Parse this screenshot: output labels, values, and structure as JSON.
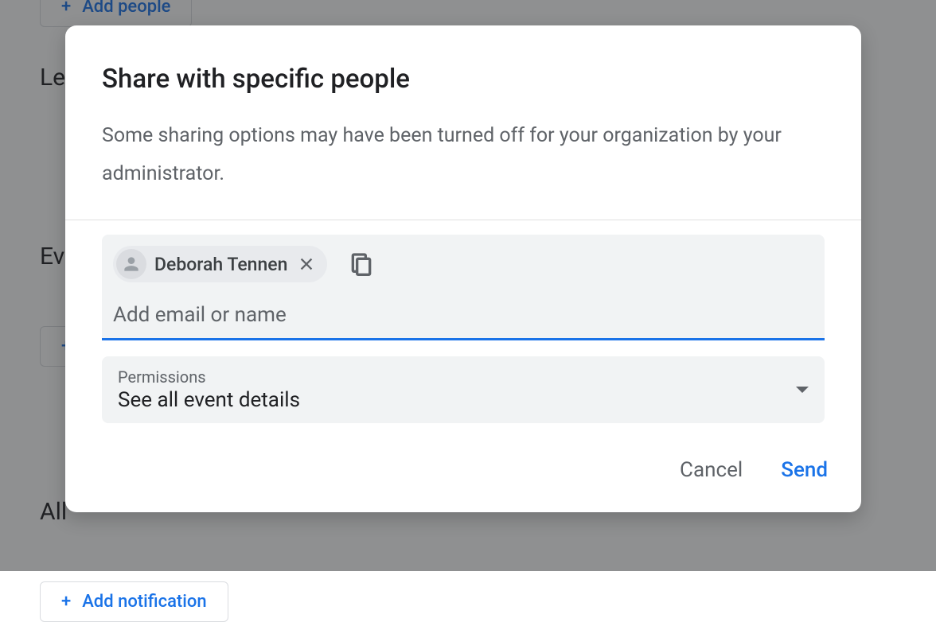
{
  "background": {
    "add_people_label": "Add people",
    "learn_text": "Lea",
    "event_text": "Ev",
    "all_text": "All",
    "notification_label": "Add notification"
  },
  "modal": {
    "title": "Share with specific people",
    "subtitle": "Some sharing options may have been turned off for your organization by your administrator.",
    "chip_name": "Deborah Tennen",
    "input_placeholder": "Add email or name",
    "permissions_label": "Permissions",
    "permissions_value": "See all event details",
    "cancel_label": "Cancel",
    "send_label": "Send"
  }
}
